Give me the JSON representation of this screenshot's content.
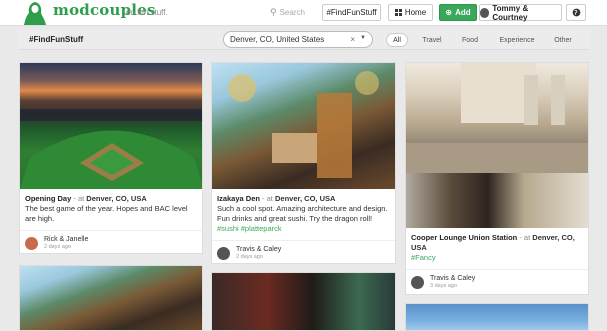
{
  "header": {
    "brand": "modcouples",
    "tagline": "do fun stuff.",
    "search_placeholder": "Search",
    "hashtag_button": "#FindFunStuff",
    "home_button": "Home",
    "add_button": "Add",
    "user_button": "Tommy & Courtney"
  },
  "filter": {
    "title": "#FindFunStuff",
    "location": "Denver, CO, United States",
    "categories": [
      "All",
      "Travel",
      "Food",
      "Experience",
      "Other"
    ],
    "active_category": "All"
  },
  "cards": [
    {
      "title": "Opening Day",
      "at": "- at",
      "city": "Denver, CO, USA",
      "description": "The best game of the year. Hopes and BAC level are high.",
      "tags": "",
      "author": "Rick & Janelle",
      "time": "2 days ago"
    },
    {
      "title": "Izakaya Den",
      "at": "- at",
      "city": "Denver, CO, USA",
      "description": "Such a cool spot. Amazing architecture and design. Fun drinks and great sushi. Try the dragon roll!",
      "tags": "#sushi #platteparck",
      "author": "Travis & Caley",
      "time": "2 days ago"
    },
    {
      "title": "Cooper Lounge Union Station",
      "at": "- at",
      "city": "Denver, CO, USA",
      "description": "",
      "tags": "#Fancy",
      "author": "Travis & Caley",
      "time": "3 days ago"
    }
  ],
  "colors": {
    "brand_green": "#2e9e4d",
    "add_green": "#3aa85a",
    "tag_green": "#3aa85a",
    "page_bg": "#e9e9e9"
  },
  "icons": {
    "logo": "cloaked-figure-logo",
    "search": "magnifier-icon",
    "home": "grid-icon",
    "add": "plus-circle-icon",
    "globe": "globe-icon"
  }
}
